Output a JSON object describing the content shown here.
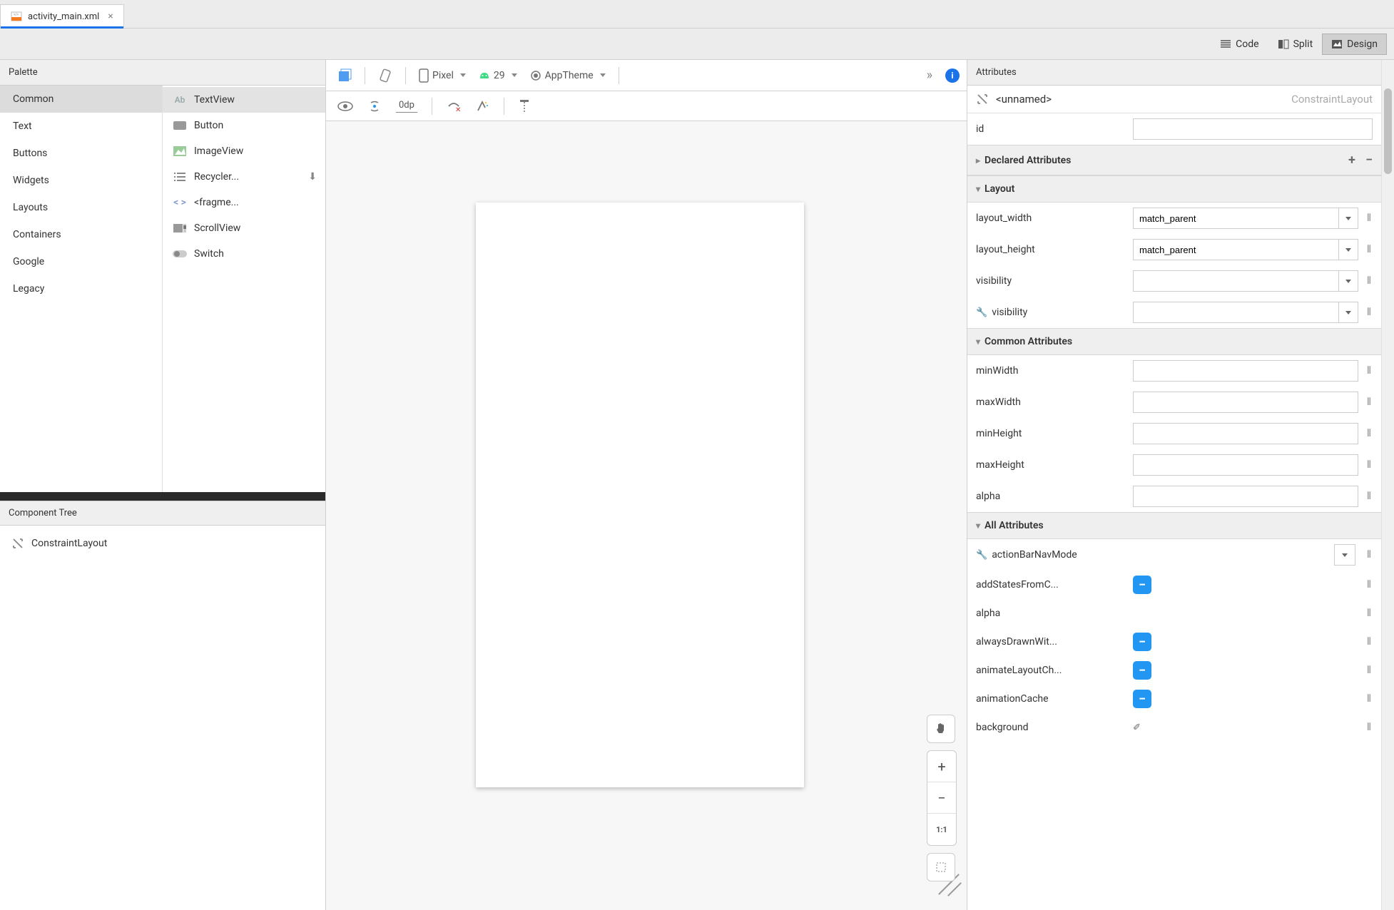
{
  "tab": {
    "filename": "activity_main.xml"
  },
  "views": {
    "code": "Code",
    "split": "Split",
    "design": "Design"
  },
  "palette": {
    "title": "Palette",
    "categories": [
      "Common",
      "Text",
      "Buttons",
      "Widgets",
      "Layouts",
      "Containers",
      "Google",
      "Legacy"
    ],
    "active": "Common",
    "items": [
      {
        "label": "TextView",
        "icon": "text"
      },
      {
        "label": "Button",
        "icon": "button"
      },
      {
        "label": "ImageView",
        "icon": "image"
      },
      {
        "label": "Recycler...",
        "icon": "list",
        "download": true
      },
      {
        "label": "<fragme...",
        "icon": "code"
      },
      {
        "label": "ScrollView",
        "icon": "scroll"
      },
      {
        "label": "Switch",
        "icon": "switch"
      }
    ]
  },
  "componentTree": {
    "title": "Component Tree",
    "root": "ConstraintLayout"
  },
  "designToolbar": {
    "device": "Pixel",
    "api": "29",
    "theme": "AppTheme",
    "margin": "0dp"
  },
  "zoom": {
    "ratio": "1:1"
  },
  "attributes": {
    "title": "Attributes",
    "unnamed": "<unnamed>",
    "type": "ConstraintLayout",
    "id_label": "id",
    "sections": {
      "declared": "Declared Attributes",
      "layout": "Layout",
      "common": "Common Attributes",
      "all": "All Attributes"
    },
    "layout": {
      "layout_width": {
        "label": "layout_width",
        "value": "match_parent"
      },
      "layout_height": {
        "label": "layout_height",
        "value": "match_parent"
      },
      "visibility": {
        "label": "visibility",
        "value": ""
      },
      "tools_visibility": {
        "label": "visibility",
        "value": ""
      }
    },
    "common": {
      "minWidth": "minWidth",
      "maxWidth": "maxWidth",
      "minHeight": "minHeight",
      "maxHeight": "maxHeight",
      "alpha": "alpha"
    },
    "all": [
      {
        "label": "actionBarNavMode",
        "type": "select",
        "wrench": true
      },
      {
        "label": "addStatesFromC...",
        "type": "bool"
      },
      {
        "label": "alpha",
        "type": "text"
      },
      {
        "label": "alwaysDrawnWit...",
        "type": "bool"
      },
      {
        "label": "animateLayoutCh...",
        "type": "bool"
      },
      {
        "label": "animationCache",
        "type": "bool"
      },
      {
        "label": "background",
        "type": "eyedropper"
      }
    ]
  }
}
